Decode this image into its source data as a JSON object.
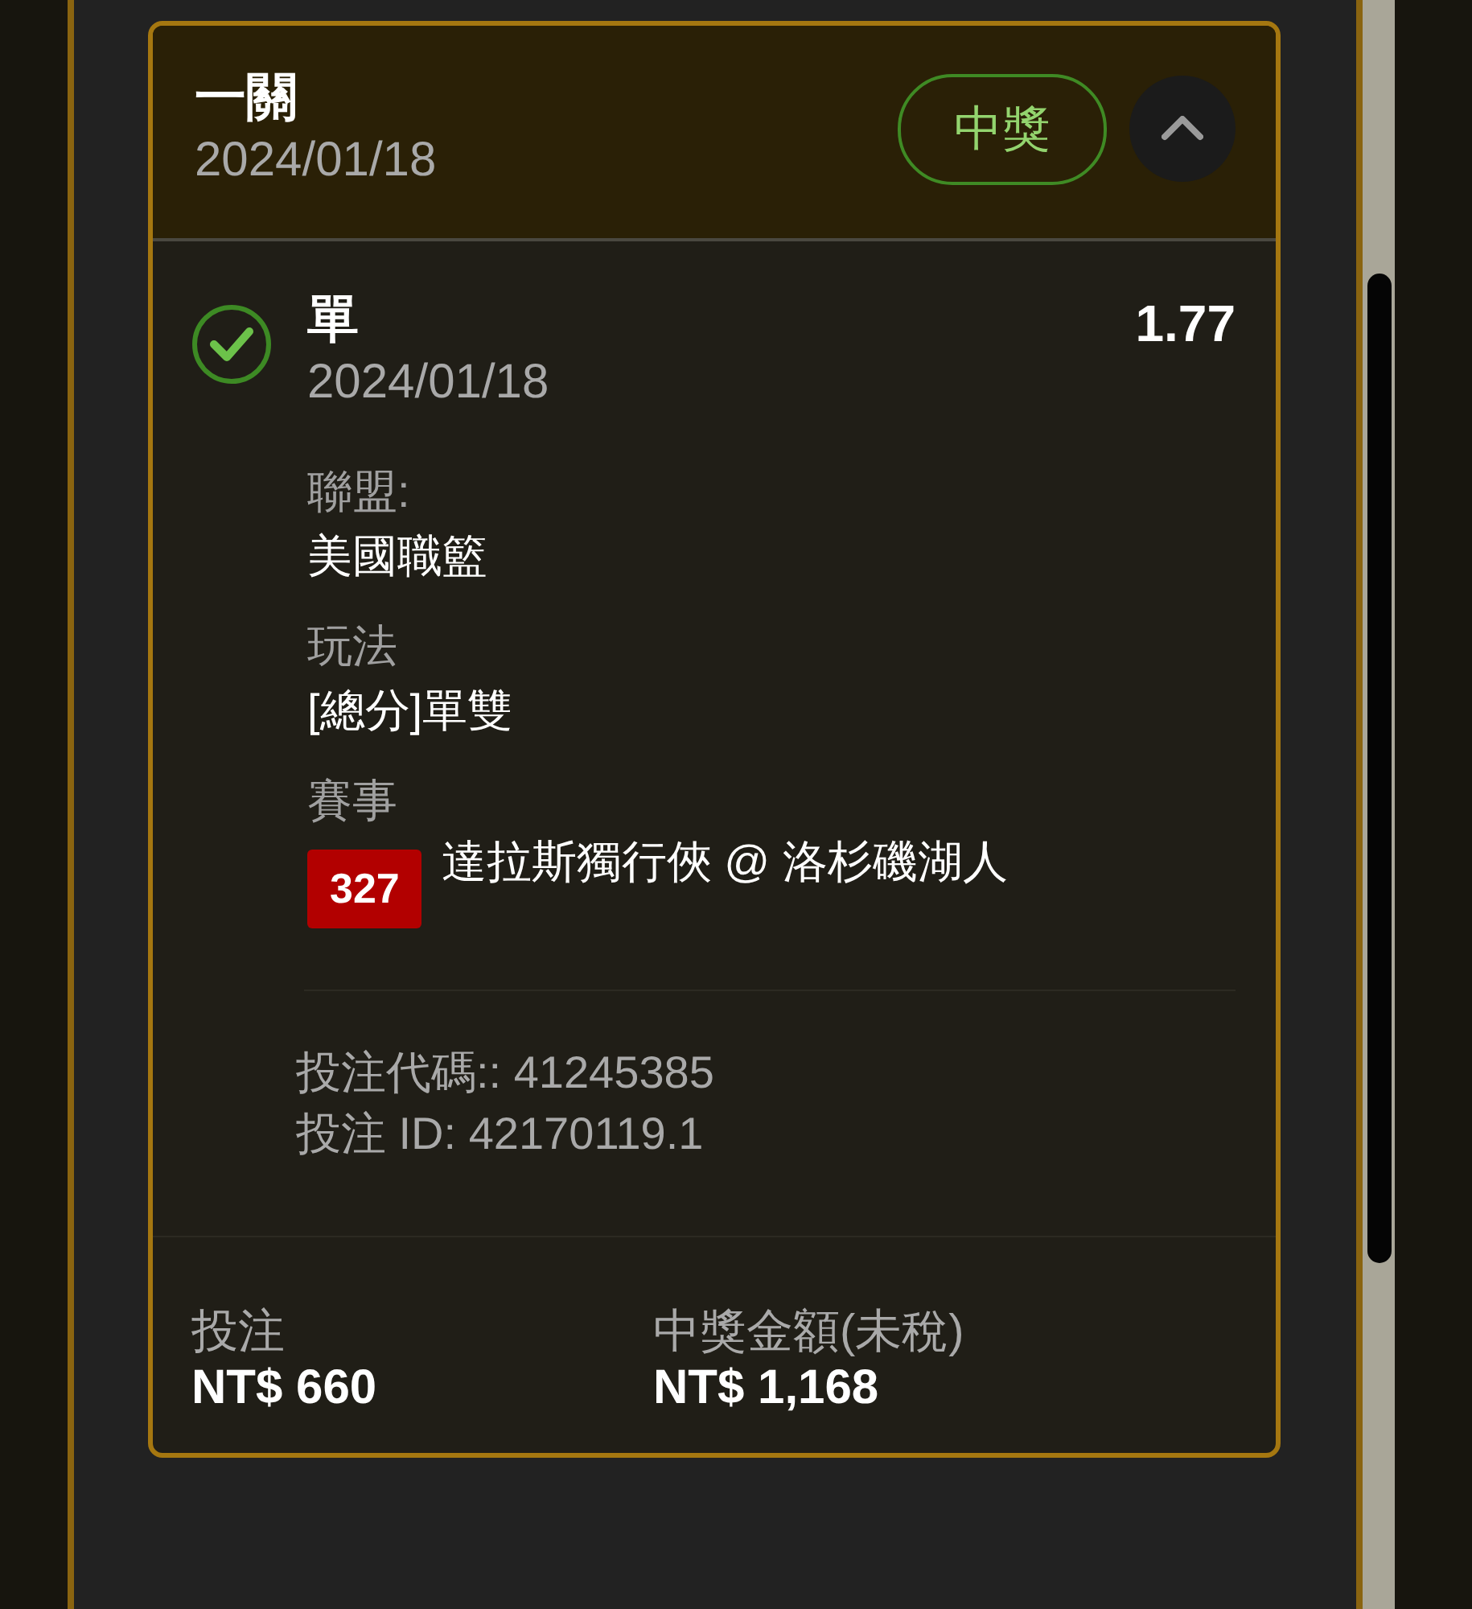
{
  "ticket": {
    "title": "一關",
    "date": "2024/01/18",
    "status": "中獎",
    "expanded": true
  },
  "bet": {
    "won": true,
    "name": "單",
    "date": "2024/01/18",
    "odds": "1.77",
    "details": [
      {
        "label": "聯盟:",
        "value": "美國職籃"
      },
      {
        "label": "玩法",
        "value": "[總分]單雙"
      }
    ],
    "event": {
      "label": "賽事",
      "number": "327",
      "name": "達拉斯獨行俠 @ 洛杉磯湖人"
    }
  },
  "codes": [
    "投注代碼:: 41245385",
    "投注 ID: 42170119.1"
  ],
  "summary": [
    {
      "label": "投注",
      "value": "NT$ 660"
    },
    {
      "label": "中獎金額(未稅)",
      "value": "NT$ 1,168"
    }
  ]
}
